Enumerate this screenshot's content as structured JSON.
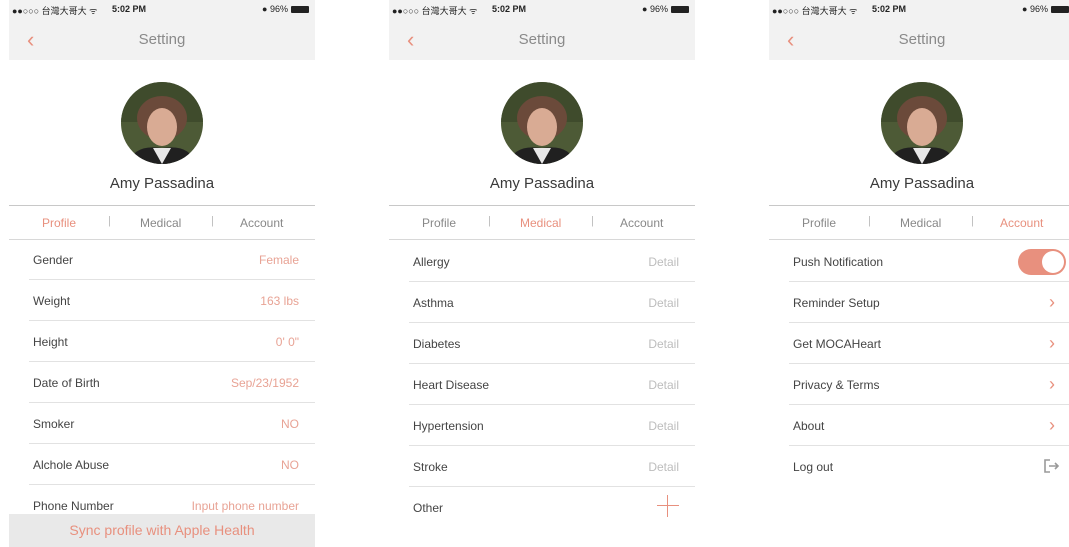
{
  "status": {
    "carrier": "●●○○○ 台灣大哥大 ᯤ",
    "time": "5:02 PM",
    "battery": "● 96%"
  },
  "header": {
    "title": "Setting",
    "back_icon": "‹"
  },
  "user": {
    "name": "Amy Passadina"
  },
  "tabs": {
    "profile": "Profile",
    "medical": "Medical",
    "account": "Account",
    "separator": "|"
  },
  "colors": {
    "accent": "#e8907e",
    "row_value": "#e8a395",
    "detail_gray": "#bdbdbd"
  },
  "profile": {
    "rows": [
      {
        "label": "Gender",
        "value": "Female"
      },
      {
        "label": "Weight",
        "value": "163 lbs"
      },
      {
        "label": "Height",
        "value": "0' 0\""
      },
      {
        "label": "Date of Birth",
        "value": "Sep/23/1952"
      },
      {
        "label": "Smoker",
        "value": "NO"
      },
      {
        "label": "Alchole Abuse",
        "value": "NO"
      },
      {
        "label": "Phone Number",
        "value": "Input phone number"
      }
    ],
    "sync_label": "Sync profile with Apple Health"
  },
  "medical": {
    "rows": [
      {
        "label": "Allergy",
        "value": "Detail"
      },
      {
        "label": "Asthma",
        "value": "Detail"
      },
      {
        "label": "Diabetes",
        "value": "Detail"
      },
      {
        "label": "Heart Disease",
        "value": "Detail"
      },
      {
        "label": "Hypertension",
        "value": "Detail"
      },
      {
        "label": "Stroke",
        "value": "Detail"
      },
      {
        "label": "Other",
        "icon": "plus-icon"
      }
    ]
  },
  "account": {
    "rows": [
      {
        "label": "Push Notification",
        "control": "toggle",
        "on": true
      },
      {
        "label": "Reminder Setup",
        "chevron": "›"
      },
      {
        "label": "Get MOCAHeart",
        "chevron": "›"
      },
      {
        "label": "Privacy & Terms",
        "chevron": "›"
      },
      {
        "label": "About",
        "chevron": "›"
      },
      {
        "label": "Log out",
        "icon": "logout-icon"
      }
    ]
  }
}
